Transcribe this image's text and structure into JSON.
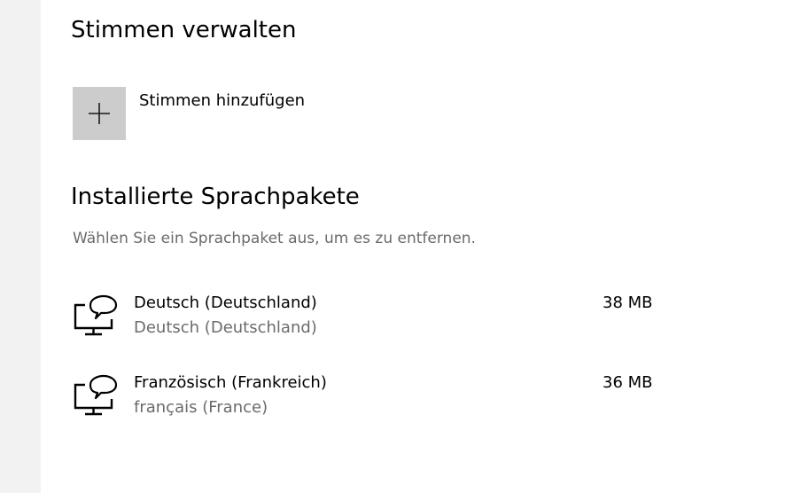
{
  "manage_voices": {
    "heading": "Stimmen verwalten",
    "add_voice_label": "Stimmen hinzufügen",
    "add_icon": "plus-icon"
  },
  "installed_packs": {
    "heading": "Installierte Sprachpakete",
    "hint": "Wählen Sie ein Sprachpaket aus, um es zu entfernen.",
    "items": [
      {
        "name": "Deutsch (Deutschland)",
        "native_name": "Deutsch (Deutschland)",
        "size": "38 MB",
        "icon": "speech-monitor-icon"
      },
      {
        "name": "Französisch (Frankreich)",
        "native_name": "français (France)",
        "size": "36 MB",
        "icon": "speech-monitor-icon"
      }
    ]
  },
  "colors": {
    "background": "#ffffff",
    "sidebar": "#f2f2f2",
    "tile": "#cccccc",
    "secondary_text": "#6b6b6b"
  }
}
